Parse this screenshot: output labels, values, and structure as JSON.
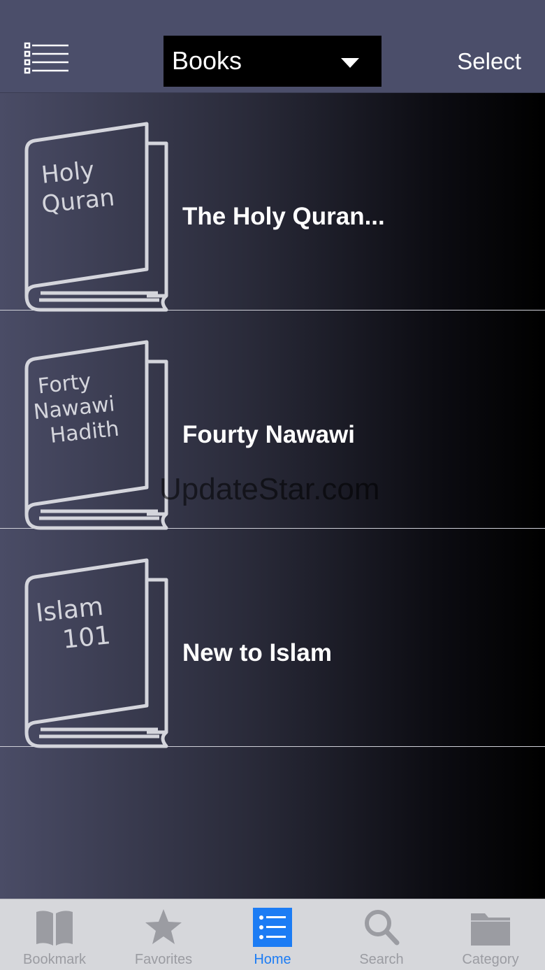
{
  "navbar": {
    "menu_icon": "list-menu-icon",
    "dropdown_label": "Books",
    "dropdown_icon": "caret-down-icon",
    "select_label": "Select"
  },
  "books": [
    {
      "cover_lines": [
        "Holy",
        "Quran"
      ],
      "title": "The Holy Quran..."
    },
    {
      "cover_lines": [
        "Forty",
        "Nawawi",
        "Hadith"
      ],
      "title": "Fourty Nawawi"
    },
    {
      "cover_lines": [
        "Islam",
        "101"
      ],
      "title": "New to Islam"
    }
  ],
  "watermark": "UpdateStar.com",
  "tabbar": {
    "tabs": [
      {
        "label": "Bookmark",
        "icon": "book-open-icon",
        "active": false
      },
      {
        "label": "Favorites",
        "icon": "star-icon",
        "active": false
      },
      {
        "label": "Home",
        "icon": "list-icon",
        "active": true
      },
      {
        "label": "Search",
        "icon": "search-icon",
        "active": false
      },
      {
        "label": "Category",
        "icon": "folder-icon",
        "active": false
      }
    ]
  },
  "colors": {
    "navbar": "#4b4e6a",
    "accent": "#1c7cf4",
    "tab_inactive": "#9b9ca2",
    "tabbar_bg": "#d6d7db",
    "book_stroke": "#d4d5dc"
  }
}
